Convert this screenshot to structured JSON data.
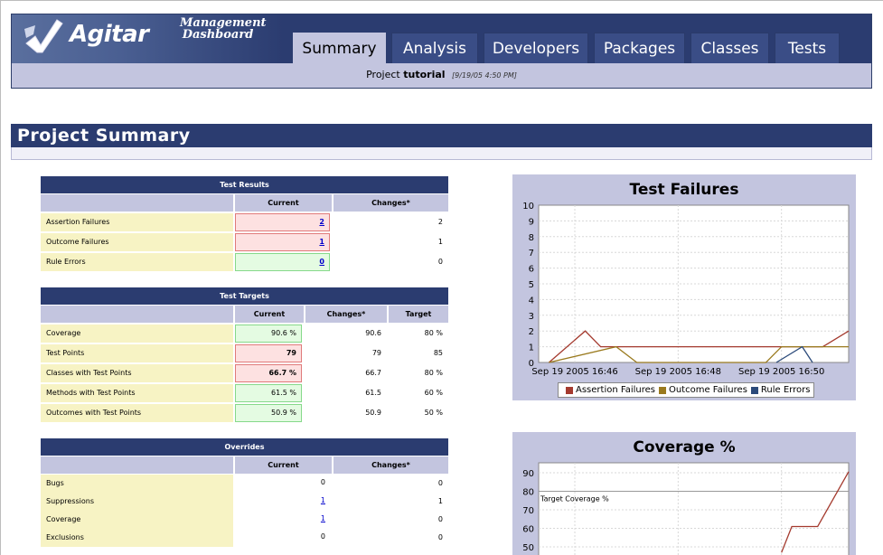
{
  "header": {
    "logo_text": "Agitar",
    "title_line1": "Management",
    "title_line2": "Dashboard",
    "tabs": [
      "Summary",
      "Analysis",
      "Developers",
      "Packages",
      "Classes",
      "Tests"
    ],
    "active_tab": "Summary",
    "project_prefix": "Project",
    "project_name": "tutorial",
    "project_time": "[9/19/05 4:50 PM]"
  },
  "section_title": "Project Summary",
  "test_results": {
    "title": "Test Results",
    "headers": [
      "Current",
      "Changes*"
    ],
    "rows": [
      {
        "label": "Assertion Failures",
        "current": "2",
        "change": "2"
      },
      {
        "label": "Outcome Failures",
        "current": "1",
        "change": "1"
      },
      {
        "label": "Rule Errors",
        "current": "0",
        "change": "0"
      }
    ]
  },
  "test_targets": {
    "title": "Test Targets",
    "headers": [
      "Current",
      "Changes*",
      "Target"
    ],
    "rows": [
      {
        "label": "Coverage",
        "current": "90.6 %",
        "change": "90.6",
        "target": "80 %"
      },
      {
        "label": "Test Points",
        "current": "79",
        "change": "79",
        "target": "85"
      },
      {
        "label": "Classes with Test Points",
        "current": "66.7 %",
        "change": "66.7",
        "target": "80 %"
      },
      {
        "label": "Methods with Test Points",
        "current": "61.5 %",
        "change": "61.5",
        "target": "60 %"
      },
      {
        "label": "Outcomes with Test Points",
        "current": "50.9 %",
        "change": "50.9",
        "target": "50 %"
      }
    ]
  },
  "overrides": {
    "title": "Overrides",
    "headers": [
      "Current",
      "Changes*"
    ],
    "rows": [
      {
        "label": "Bugs",
        "current": "0",
        "change": "0"
      },
      {
        "label": "Suppressions",
        "current": "1",
        "change": "1"
      },
      {
        "label": "Coverage",
        "current": "1",
        "change": "0"
      },
      {
        "label": "Exclusions",
        "current": "0",
        "change": "0"
      }
    ]
  },
  "colors": {
    "nav_dark": "#2b3c70",
    "lavender": "#c3c5df",
    "label_bg": "#f7f3c4",
    "bad_bg": "#fde1e1",
    "good_bg": "#e4fbe2",
    "assertion": "#a43a2e",
    "outcome": "#9a7a1e",
    "rule": "#2b4a7a"
  },
  "chart_data": [
    {
      "type": "line",
      "title": "Test Failures",
      "ylim": [
        0,
        10
      ],
      "yticks": [
        "0",
        "1",
        "2",
        "3",
        "4",
        "5",
        "6",
        "7",
        "8",
        "9",
        "10"
      ],
      "xticks": [
        "Sep 19 2005 16:46",
        "Sep 19 2005 16:48",
        "Sep 19 2005 16:50"
      ],
      "legend_position": "bottom",
      "grid": true,
      "series": [
        {
          "name": "Assertion Failures",
          "x": [
            "16:45.5",
            "16:46.2",
            "16:46.5",
            "16:50.8",
            "16:51.3"
          ],
          "values": [
            0,
            2,
            1,
            1,
            2
          ]
        },
        {
          "name": "Outcome Failures",
          "x": [
            "16:45.5",
            "16:46.8",
            "16:47.2",
            "16:49.7",
            "16:50.0",
            "16:51.3"
          ],
          "values": [
            0,
            1,
            0,
            0,
            1,
            1
          ]
        },
        {
          "name": "Rule Errors",
          "x": [
            "16:49.9",
            "16:50.4",
            "16:50.6"
          ],
          "values": [
            0,
            1,
            0
          ]
        }
      ]
    },
    {
      "type": "line",
      "title": "Coverage %",
      "ylim": [
        50,
        90
      ],
      "yticks": [
        "50",
        "60",
        "70",
        "80",
        "90"
      ],
      "grid": true,
      "annotation": "Target Coverage %",
      "target": 80,
      "series": [
        {
          "name": "Coverage",
          "x": [
            "16:50.0",
            "16:50.2",
            "16:50.7",
            "16:51.3"
          ],
          "values": [
            47,
            61,
            61,
            90.6
          ]
        }
      ]
    }
  ]
}
